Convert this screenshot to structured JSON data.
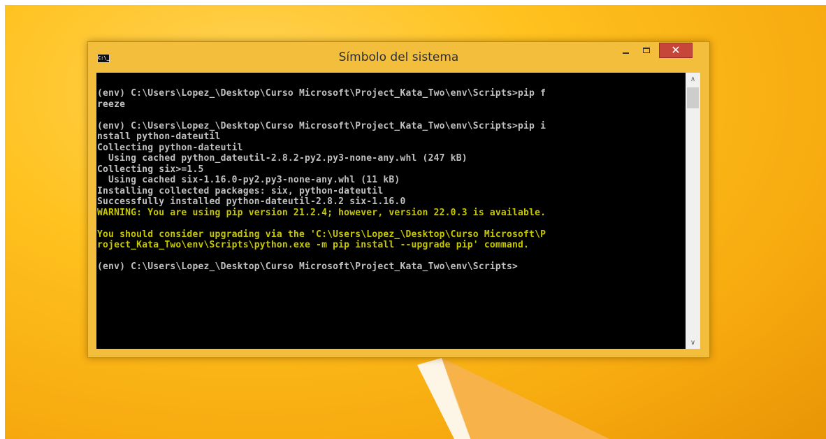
{
  "window": {
    "title": "Símbolo del sistema",
    "system_icon_text": "C:\\_",
    "buttons": {
      "minimize": "minimize-icon",
      "maximize": "maximize-icon",
      "close": "close-icon"
    },
    "colors": {
      "frame": "#f2be3c",
      "close": "#c7463a",
      "console_bg": "#000000",
      "text": "#c0c0c0",
      "warning": "#c8c800"
    }
  },
  "console": {
    "lines": [
      {
        "text": "(env) C:\\Users\\Lopez_\\Desktop\\Curso Microsoft\\Project_Kata_Two\\env\\Scripts>pip f",
        "type": "normal"
      },
      {
        "text": "reeze",
        "type": "normal"
      },
      {
        "text": "",
        "type": "normal"
      },
      {
        "text": "(env) C:\\Users\\Lopez_\\Desktop\\Curso Microsoft\\Project_Kata_Two\\env\\Scripts>pip i",
        "type": "normal"
      },
      {
        "text": "nstall python-dateutil",
        "type": "normal"
      },
      {
        "text": "Collecting python-dateutil",
        "type": "normal"
      },
      {
        "text": "  Using cached python_dateutil-2.8.2-py2.py3-none-any.whl (247 kB)",
        "type": "normal"
      },
      {
        "text": "Collecting six>=1.5",
        "type": "normal"
      },
      {
        "text": "  Using cached six-1.16.0-py2.py3-none-any.whl (11 kB)",
        "type": "normal"
      },
      {
        "text": "Installing collected packages: six, python-dateutil",
        "type": "normal"
      },
      {
        "text": "Successfully installed python-dateutil-2.8.2 six-1.16.0",
        "type": "normal"
      },
      {
        "text": "WARNING: You are using pip version 21.2.4; however, version 22.0.3 is available.",
        "type": "warning"
      },
      {
        "text": "",
        "type": "warning"
      },
      {
        "text": "You should consider upgrading via the 'C:\\Users\\Lopez_\\Desktop\\Curso Microsoft\\P",
        "type": "warning"
      },
      {
        "text": "roject_Kata_Two\\env\\Scripts\\python.exe -m pip install --upgrade pip' command.",
        "type": "warning"
      },
      {
        "text": "",
        "type": "normal"
      },
      {
        "text": "(env) C:\\Users\\Lopez_\\Desktop\\Curso Microsoft\\Project_Kata_Two\\env\\Scripts>",
        "type": "normal"
      }
    ]
  },
  "scrollbar": {
    "up_icon": "chevron-up-icon",
    "down_icon": "chevron-down-icon",
    "position": 0
  }
}
